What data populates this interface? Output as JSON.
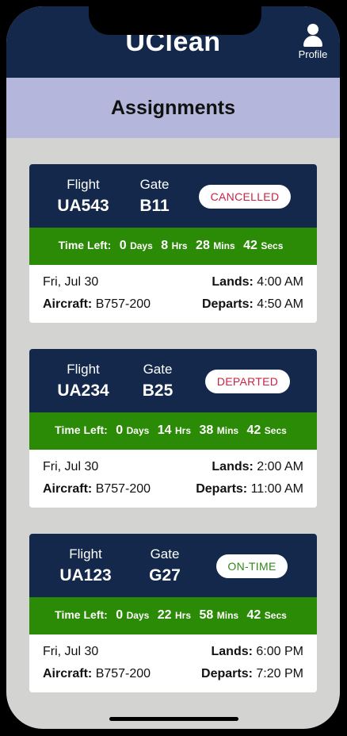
{
  "app": {
    "title": "UClean",
    "profile_label": "Profile"
  },
  "section": {
    "title": "Assignments"
  },
  "labels": {
    "flight": "Flight",
    "gate": "Gate",
    "time_left": "Time Left:",
    "days": "Days",
    "hrs": "Hrs",
    "mins": "Mins",
    "secs": "Secs",
    "aircraft": "Aircraft:",
    "lands": "Lands:",
    "departs": "Departs:"
  },
  "assignments": [
    {
      "flight": "UA543",
      "gate": "B11",
      "status": "CANCELLED",
      "time_left": {
        "days": "0",
        "hrs": "8",
        "mins": "28",
        "secs": "42"
      },
      "date": "Fri, Jul 30",
      "aircraft": "B757-200",
      "lands": "4:00 AM",
      "departs": "4:50 AM"
    },
    {
      "flight": "UA234",
      "gate": "B25",
      "status": "DEPARTED",
      "time_left": {
        "days": "0",
        "hrs": "14",
        "mins": "38",
        "secs": "42"
      },
      "date": "Fri, Jul 30",
      "aircraft": "B757-200",
      "lands": "2:00 AM",
      "departs": "11:00 AM"
    },
    {
      "flight": "UA123",
      "gate": "G27",
      "status": "ON-TIME",
      "time_left": {
        "days": "0",
        "hrs": "22",
        "mins": "58",
        "secs": "42"
      },
      "date": "Fri, Jul 30",
      "aircraft": "B757-200",
      "lands": "6:00 PM",
      "departs": "7:20 PM"
    }
  ],
  "colors": {
    "header": "#13284a",
    "section_bar": "#b4b6db",
    "time_bar": "#2b8a06",
    "background": "#d3d4d2",
    "status_alert": "#cc2244",
    "status_ok": "#2f8a17"
  }
}
